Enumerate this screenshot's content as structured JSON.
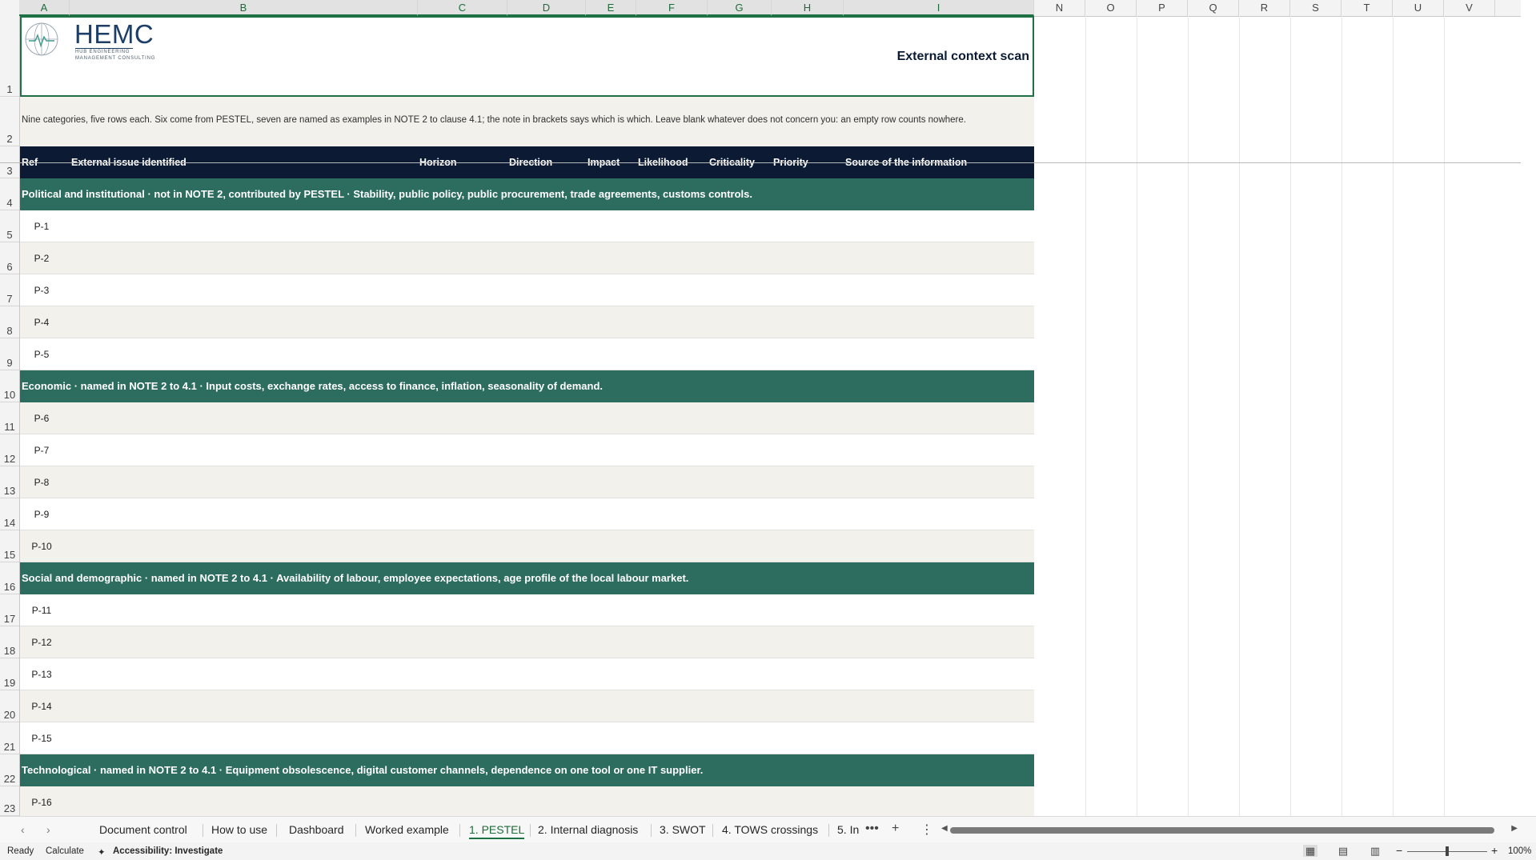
{
  "columns": [
    "A",
    "B",
    "C",
    "D",
    "E",
    "F",
    "G",
    "H",
    "I",
    "N",
    "O",
    "P",
    "Q",
    "R",
    "S",
    "T",
    "U",
    "V"
  ],
  "rows": [
    "1",
    "2",
    "3",
    "4",
    "5",
    "6",
    "7",
    "8",
    "9",
    "10",
    "11",
    "12",
    "13",
    "14",
    "15",
    "16",
    "17",
    "18",
    "19",
    "20",
    "21",
    "22",
    "23"
  ],
  "logo": {
    "brand": "HEMC",
    "sub1": "HUB ENGINEERING",
    "sub2": "MANAGEMENT CONSULTING"
  },
  "sheet_title": "External context scan",
  "instructions": "Nine categories, five rows each. Six come from PESTEL, seven are named as examples in NOTE 2 to clause 4.1; the note in brackets says which is which. Leave blank whatever does not concern you: an empty row counts nowhere.",
  "headers": {
    "ref": "Ref",
    "issue": "External issue identified",
    "horizon": "Horizon",
    "direction": "Direction",
    "impact": "Impact",
    "likelihood": "Likelihood",
    "criticality": "Criticality",
    "priority": "Priority",
    "source": "Source of the information"
  },
  "categories": {
    "political": "Political and institutional  ·  not in NOTE 2, contributed by PESTEL  ·  Stability, public policy, public procurement, trade agreements, customs controls.",
    "economic": "Economic  ·  named in NOTE 2 to 4.1  ·  Input costs, exchange rates, access to finance, inflation, seasonality of demand.",
    "social": "Social and demographic  ·  named in NOTE 2 to 4.1  ·  Availability of labour, employee expectations, age profile of the local labour market.",
    "technological": "Technological  ·  named in NOTE 2 to 4.1  ·  Equipment obsolescence, digital customer channels, dependence on one tool or one IT supplier."
  },
  "refs": [
    "P-1",
    "P-2",
    "P-3",
    "P-4",
    "P-5",
    "P-6",
    "P-7",
    "P-8",
    "P-9",
    "P-10",
    "P-11",
    "P-12",
    "P-13",
    "P-14",
    "P-15",
    "P-16"
  ],
  "tabs": {
    "document_control": "Document control",
    "how_to_use": "How to use",
    "dashboard": "Dashboard",
    "worked_example": "Worked example",
    "pestel": "1. PESTEL",
    "internal_diagnosis": "2. Internal diagnosis",
    "swot": "3. SWOT",
    "tows": "4. TOWS crossings",
    "truncated": "5. In"
  },
  "status": {
    "ready": "Ready",
    "calculate": "Calculate",
    "accessibility": "Accessibility: Investigate",
    "zoom": "100%"
  },
  "colors": {
    "header_navy": "#0c1b33",
    "category_green": "#2c6d5f",
    "band_beige": "#f3f1ec",
    "selection_green": "#1e7145"
  }
}
